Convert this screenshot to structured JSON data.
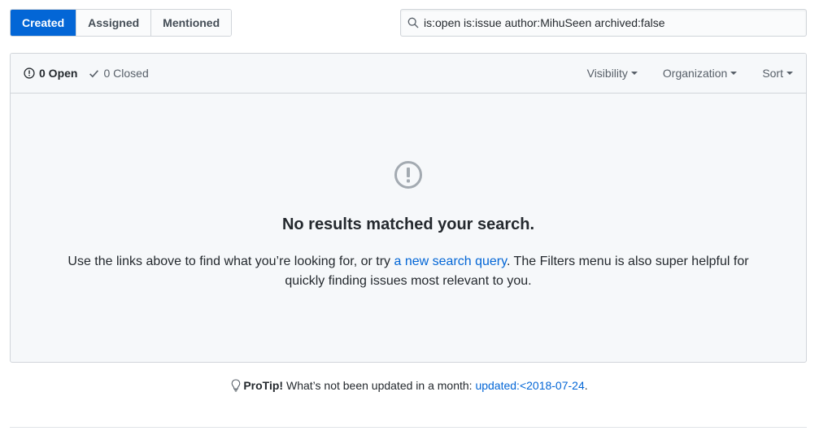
{
  "tabs": [
    {
      "label": "Created",
      "selected": true
    },
    {
      "label": "Assigned",
      "selected": false
    },
    {
      "label": "Mentioned",
      "selected": false
    }
  ],
  "search": {
    "value": "is:open is:issue author:MihuSeen archived:false",
    "icon": "search-icon"
  },
  "header": {
    "open_label": "0 Open",
    "closed_label": "0 Closed",
    "filters": [
      "Visibility",
      "Organization",
      "Sort"
    ]
  },
  "blankslate": {
    "icon": "issue-opened-icon",
    "title": "No results matched your search.",
    "text_before": "Use the links above to find what you’re looking for, or try ",
    "link_text": "a new search query",
    "text_after": ". The Filters menu is also super helpful for quickly finding issues most relevant to you."
  },
  "protip": {
    "icon": "light-bulb-icon",
    "label": "ProTip!",
    "text": " What’s not been updated in a month: ",
    "link": "updated:<2018-07-24",
    "end": "."
  },
  "colors": {
    "accent": "#0366d6",
    "border": "#d1d5da",
    "panel": "#f6f8fa",
    "text": "#24292e",
    "muted": "#586069"
  }
}
